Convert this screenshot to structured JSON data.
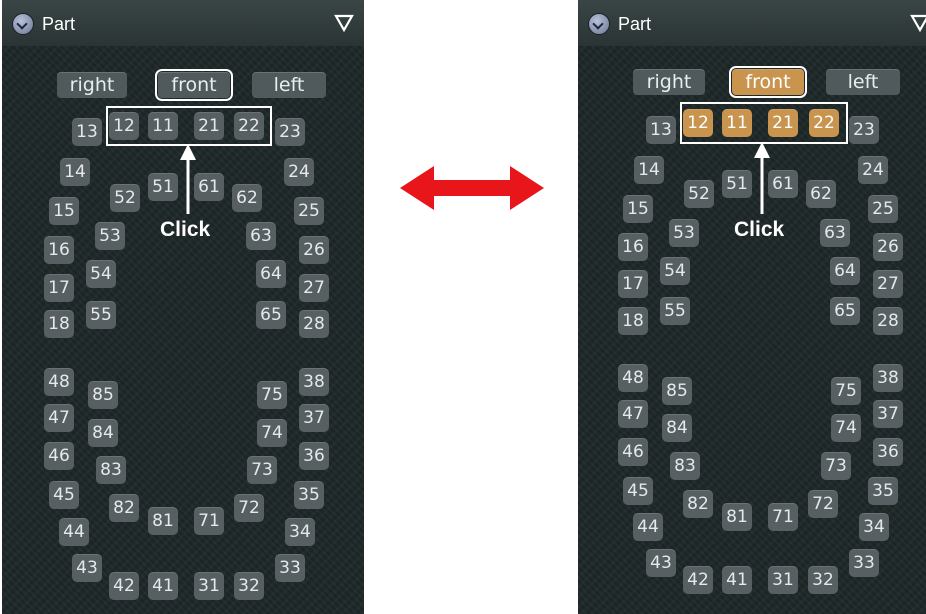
{
  "panels": [
    {
      "title": "Part",
      "views": {
        "right": "right",
        "front": "front",
        "left": "left"
      },
      "selected_state": "outline-only",
      "annotation": "Click",
      "teeth": {
        "t12": "12",
        "t11": "11",
        "t21": "21",
        "t22": "22",
        "t13": "13",
        "t23": "23",
        "t14": "14",
        "t24": "24",
        "t15": "15",
        "t25": "25",
        "t16": "16",
        "t26": "26",
        "t17": "17",
        "t27": "27",
        "t18": "18",
        "t28": "28",
        "t52": "52",
        "t51": "51",
        "t61": "61",
        "t62": "62",
        "t53": "53",
        "t63": "63",
        "t54": "54",
        "t64": "64",
        "t55": "55",
        "t65": "65",
        "t48": "48",
        "t38": "38",
        "t47": "47",
        "t37": "37",
        "t46": "46",
        "t36": "36",
        "t45": "45",
        "t35": "35",
        "t44": "44",
        "t34": "34",
        "t43": "43",
        "t33": "33",
        "t42": "42",
        "t41": "41",
        "t31": "31",
        "t32": "32",
        "t85": "85",
        "t75": "75",
        "t84": "84",
        "t74": "74",
        "t83": "83",
        "t73": "73",
        "t82": "82",
        "t72": "72",
        "t81": "81",
        "t71": "71"
      }
    },
    {
      "title": "Part",
      "views": {
        "right": "right",
        "front": "front",
        "left": "left"
      },
      "selected_state": "highlighted",
      "annotation": "Click",
      "teeth": {
        "t12": "12",
        "t11": "11",
        "t21": "21",
        "t22": "22",
        "t13": "13",
        "t23": "23",
        "t14": "14",
        "t24": "24",
        "t15": "15",
        "t25": "25",
        "t16": "16",
        "t26": "26",
        "t17": "17",
        "t27": "27",
        "t18": "18",
        "t28": "28",
        "t52": "52",
        "t51": "51",
        "t61": "61",
        "t62": "62",
        "t53": "53",
        "t63": "63",
        "t54": "54",
        "t64": "64",
        "t55": "55",
        "t65": "65",
        "t48": "48",
        "t38": "38",
        "t47": "47",
        "t37": "37",
        "t46": "46",
        "t36": "36",
        "t45": "45",
        "t35": "35",
        "t44": "44",
        "t34": "34",
        "t43": "43",
        "t33": "33",
        "t42": "42",
        "t41": "41",
        "t31": "31",
        "t32": "32",
        "t85": "85",
        "t75": "75",
        "t84": "84",
        "t74": "74",
        "t83": "83",
        "t73": "73",
        "t82": "82",
        "t72": "72",
        "t81": "81",
        "t71": "71"
      }
    }
  ],
  "colors": {
    "panel_bg": "#1e2727",
    "tooth_bg": "#575f63",
    "selected_bg": "#c8944e",
    "arrow_red": "#e8161b"
  }
}
